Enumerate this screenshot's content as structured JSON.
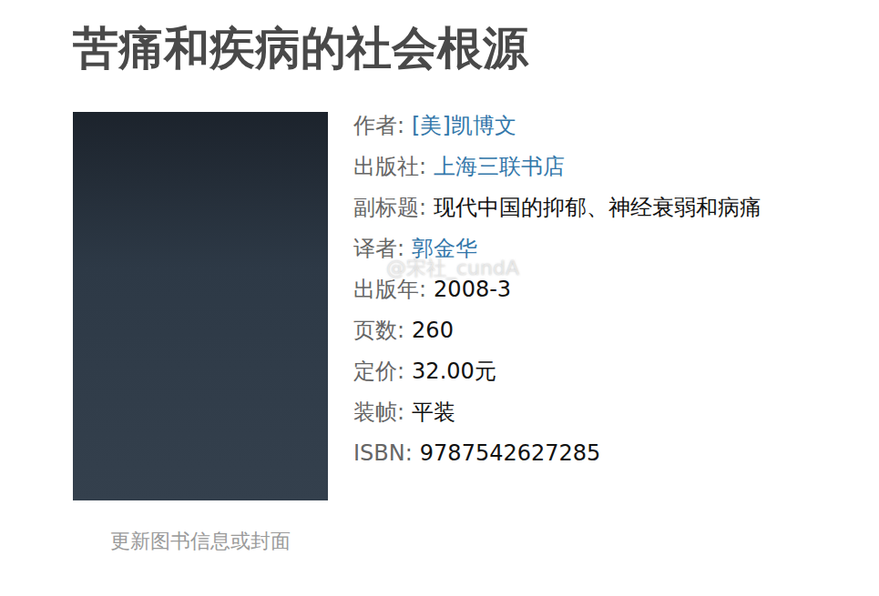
{
  "title": "苦痛和疾病的社会根源",
  "cover": {
    "alt": "book-cover"
  },
  "info": [
    {
      "label": "作者:",
      "value": "[美]凯博文",
      "link": true
    },
    {
      "label": "出版社:",
      "value": "上海三联书店",
      "link": true
    },
    {
      "label": "副标题:",
      "value": "现代中国的抑郁、神经衰弱和病痛",
      "link": false
    },
    {
      "label": "译者:",
      "value": "郭金华",
      "link": true
    },
    {
      "label": "出版年:",
      "value": "2008-3",
      "link": false
    },
    {
      "label": "页数:",
      "value": "260",
      "link": false
    },
    {
      "label": "定价:",
      "value": "32.00元",
      "link": false
    },
    {
      "label": "装帧:",
      "value": "平装",
      "link": false
    },
    {
      "label": "ISBN:",
      "value": "9787542627285",
      "link": false
    }
  ],
  "update_link": "更新图书信息或封面",
  "watermark": "@宋社_cundA"
}
